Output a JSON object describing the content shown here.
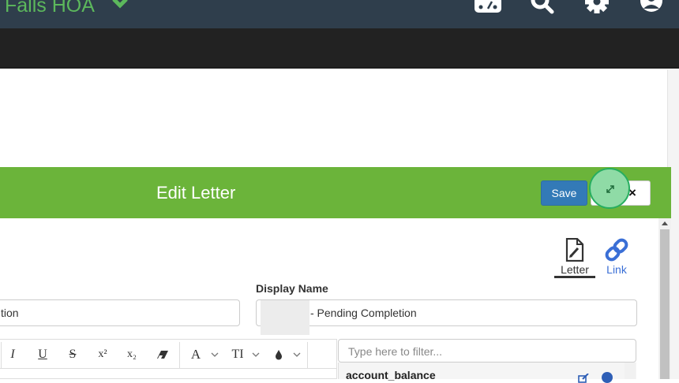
{
  "topbar": {
    "brand": "Falls HOA",
    "icons": [
      "dashboard-icon",
      "search-icon",
      "gear-icon",
      "user-icon"
    ]
  },
  "modal": {
    "title": "Edit Letter",
    "save_label": "Save",
    "close_label": "×",
    "tabs": [
      {
        "label": "Letter",
        "icon": "document-edit-icon",
        "active": true
      },
      {
        "label": "Link",
        "icon": "link-icon",
        "active": false
      }
    ],
    "left_field_value": "tion",
    "display_name": {
      "label": "Display Name",
      "value": "- Pending Completion"
    },
    "toolbar": {
      "items": [
        "I",
        "U",
        "S",
        "x²",
        "x₂",
        "A",
        "TI"
      ]
    },
    "filter": {
      "placeholder": "Type here to filter..."
    },
    "variables": [
      "account_balance"
    ]
  },
  "colors": {
    "topbar": "#2f3e4c",
    "header_green": "#6bb43a",
    "brand_green": "#5cb85c",
    "save_blue": "#337ab7",
    "link_blue": "#3a6fd6"
  }
}
